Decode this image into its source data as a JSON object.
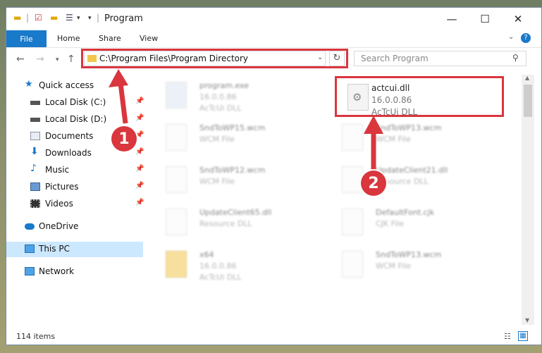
{
  "window": {
    "title": "Program"
  },
  "ribbon": {
    "file": "File",
    "home": "Home",
    "share": "Share",
    "view": "View",
    "help": "?"
  },
  "address": {
    "path": "C:\\Program Files\\Program Directory"
  },
  "search": {
    "placeholder": "Search Program"
  },
  "sidebar": {
    "items": [
      {
        "label": "Quick access"
      },
      {
        "label": "Local Disk (C:)"
      },
      {
        "label": "Local Disk (D:)"
      },
      {
        "label": "Documents"
      },
      {
        "label": "Downloads"
      },
      {
        "label": "Music"
      },
      {
        "label": "Pictures"
      },
      {
        "label": "Videos"
      },
      {
        "label": "OneDrive"
      },
      {
        "label": "This PC"
      },
      {
        "label": "Network"
      }
    ]
  },
  "files": [
    {
      "name": "program.exe",
      "line2": "16.0.0.86",
      "line3": "AcTcUi DLL"
    },
    {
      "name": "actcui.dll",
      "line2": "16.0.0.86",
      "line3": "AcTcUi DLL"
    },
    {
      "name": "SndToWP15.wcm",
      "line2": "WCM File",
      "line3": ""
    },
    {
      "name": "SndToWP13.wcm",
      "line2": "WCM File",
      "line3": ""
    },
    {
      "name": "SndToWP12.wcm",
      "line2": "WCM File",
      "line3": ""
    },
    {
      "name": "UpdateClient21.dll",
      "line2": "Resource DLL",
      "line3": ""
    },
    {
      "name": "UpdateClient65.dll",
      "line2": "Resource DLL",
      "line3": ""
    },
    {
      "name": "DefaultFont.cjk",
      "line2": "CJK File",
      "line3": ""
    },
    {
      "name": "x64",
      "line2": "16.0.0.86",
      "line3": "AcTcUi DLL"
    },
    {
      "name": "SndToWP13.wcm",
      "line2": "WCM File",
      "line3": ""
    }
  ],
  "status": {
    "count": "114 items"
  },
  "callouts": {
    "one": "1",
    "two": "2"
  },
  "colors": {
    "accent": "#1979ca",
    "highlight": "#d9363e",
    "selected": "#cce8ff"
  }
}
